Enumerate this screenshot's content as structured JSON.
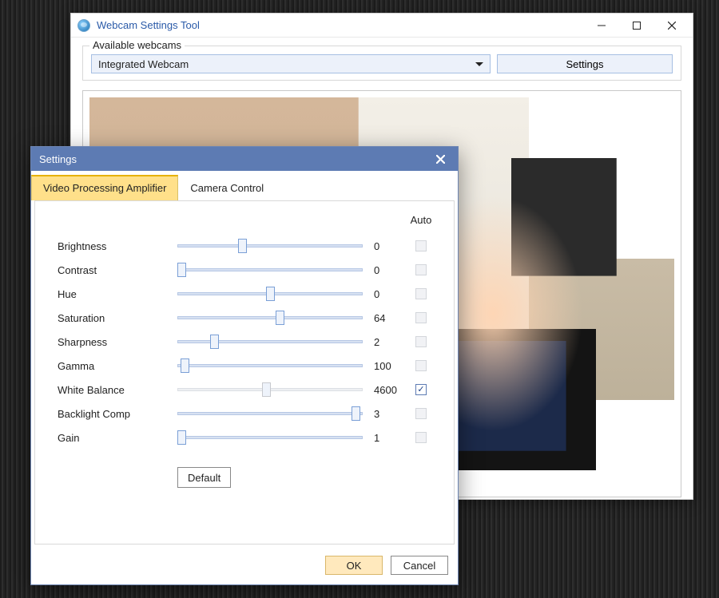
{
  "app": {
    "title": "Webcam Settings Tool",
    "groupbox_legend": "Available webcams",
    "selected_webcam": "Integrated Webcam",
    "settings_button": "Settings"
  },
  "dialog": {
    "title": "Settings",
    "tabs": [
      {
        "label": "Video Processing Amplifier",
        "active": true
      },
      {
        "label": "Camera Control",
        "active": false
      }
    ],
    "auto_header": "Auto",
    "default_button": "Default",
    "ok_button": "OK",
    "cancel_button": "Cancel",
    "sliders": [
      {
        "label": "Brightness",
        "value": 0,
        "pos": 0.35,
        "auto_checked": false,
        "auto_enabled": false,
        "enabled": true
      },
      {
        "label": "Contrast",
        "value": 0,
        "pos": 0.02,
        "auto_checked": false,
        "auto_enabled": false,
        "enabled": true
      },
      {
        "label": "Hue",
        "value": 0,
        "pos": 0.5,
        "auto_checked": false,
        "auto_enabled": false,
        "enabled": true
      },
      {
        "label": "Saturation",
        "value": 64,
        "pos": 0.55,
        "auto_checked": false,
        "auto_enabled": false,
        "enabled": true
      },
      {
        "label": "Sharpness",
        "value": 2,
        "pos": 0.2,
        "auto_checked": false,
        "auto_enabled": false,
        "enabled": true
      },
      {
        "label": "Gamma",
        "value": 100,
        "pos": 0.04,
        "auto_checked": false,
        "auto_enabled": false,
        "enabled": true
      },
      {
        "label": "White Balance",
        "value": 4600,
        "pos": 0.48,
        "auto_checked": true,
        "auto_enabled": true,
        "enabled": false
      },
      {
        "label": "Backlight Comp",
        "value": 3,
        "pos": 0.96,
        "auto_checked": false,
        "auto_enabled": false,
        "enabled": true
      },
      {
        "label": "Gain",
        "value": 1,
        "pos": 0.02,
        "auto_checked": false,
        "auto_enabled": false,
        "enabled": true
      }
    ]
  }
}
